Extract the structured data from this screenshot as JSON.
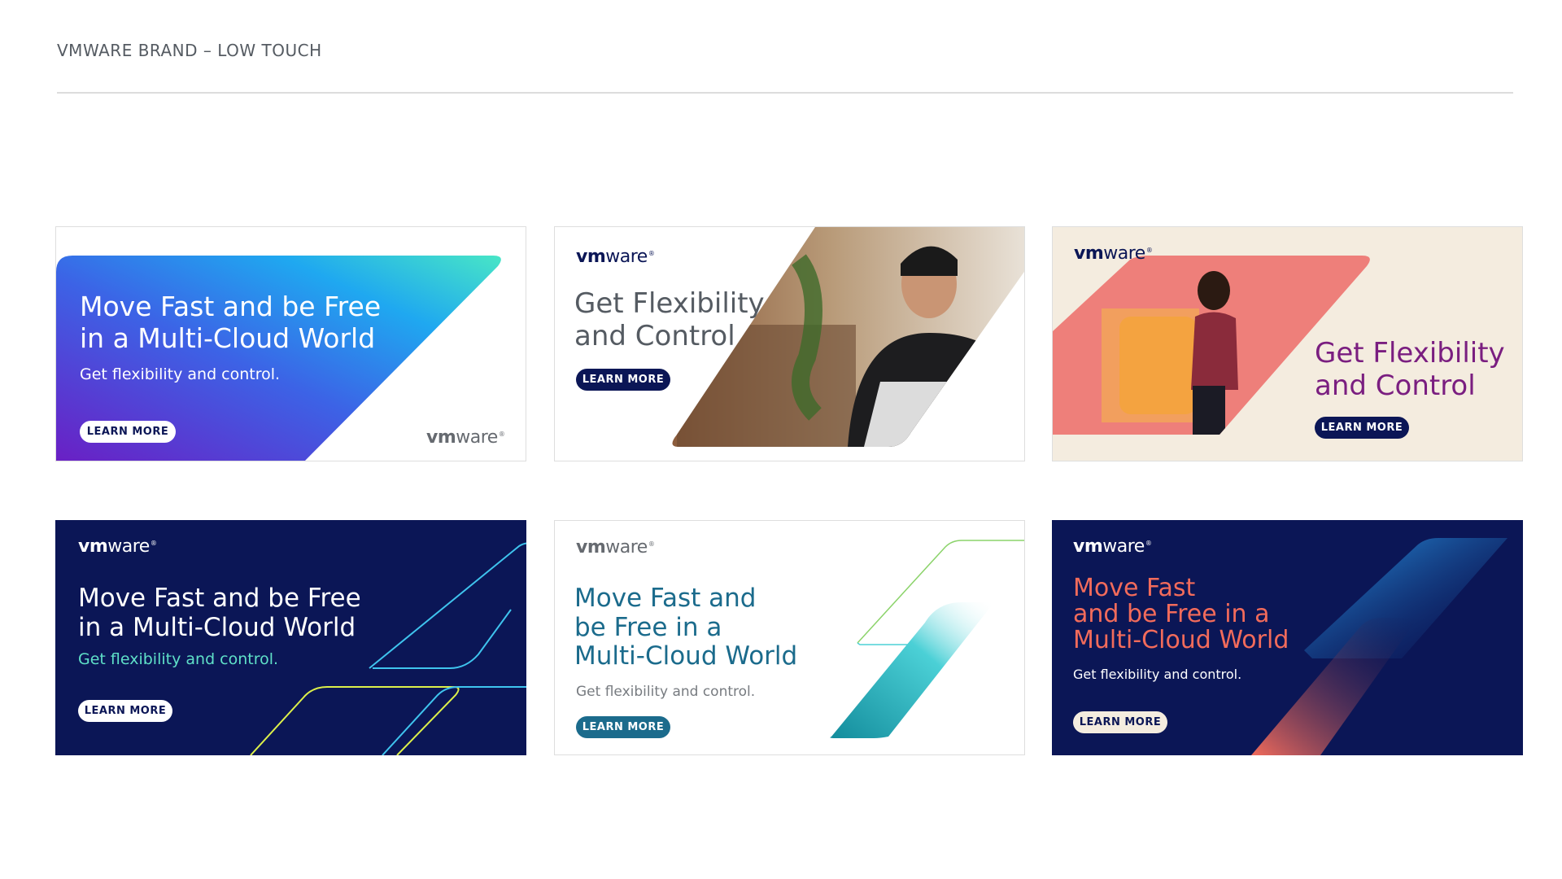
{
  "page": {
    "title": "VMWARE BRAND – LOW TOUCH"
  },
  "logo": {
    "vm": "vm",
    "ware": "ware",
    "reg": "®"
  },
  "banners": [
    {
      "headline": "Move Fast and be Free\nin a Multi-Cloud World",
      "sub": "Get flexibility and control.",
      "button": "LEARN MORE"
    },
    {
      "headline": "Get Flexibility\nand Control",
      "button": "LEARN MORE"
    },
    {
      "headline": "Get Flexibility\nand Control",
      "button": "LEARN MORE"
    },
    {
      "headline": "Move Fast and be Free\nin a Multi-Cloud World",
      "sub": "Get flexibility and control.",
      "button": "LEARN MORE"
    },
    {
      "headline": "Move Fast and\nbe Free in a\nMulti-Cloud World",
      "sub": "Get flexibility and control.",
      "button": "LEARN MORE"
    },
    {
      "headline": "Move Fast\nand be Free in a\nMulti-Cloud World",
      "sub": "Get flexibility and control.",
      "button": "LEARN MORE"
    }
  ],
  "colors": {
    "navy": "#0b1656",
    "purple": "#7a1e80",
    "teal": "#1b6b8c",
    "coral": "#f26b5b",
    "cream": "#f4ecdf",
    "gradient_start": "#6a1fc4",
    "gradient_end": "#48e6c6"
  }
}
